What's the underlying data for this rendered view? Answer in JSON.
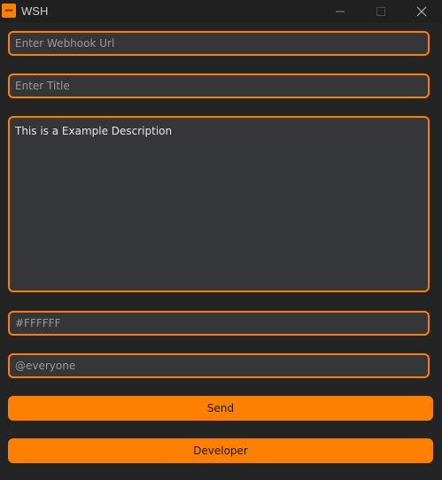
{
  "window": {
    "title": "WSH",
    "icon": "app-logo-icon",
    "icon_text": "WSH",
    "accent_color": "#FF8000",
    "background_color": "#242424"
  },
  "titlebar_buttons": {
    "minimize": "minimize-icon",
    "maximize": "maximize-icon",
    "close": "close-icon"
  },
  "form": {
    "webhook_url": {
      "value": "",
      "placeholder": "Enter Webhook Url"
    },
    "title": {
      "value": "",
      "placeholder": "Enter Title"
    },
    "description": {
      "value": "This is a Example Description"
    },
    "color": {
      "value": "",
      "placeholder": "#FFFFFF"
    },
    "mention": {
      "value": "",
      "placeholder": "@everyone"
    }
  },
  "buttons": {
    "send_label": "Send",
    "developer_label": "Developer"
  }
}
